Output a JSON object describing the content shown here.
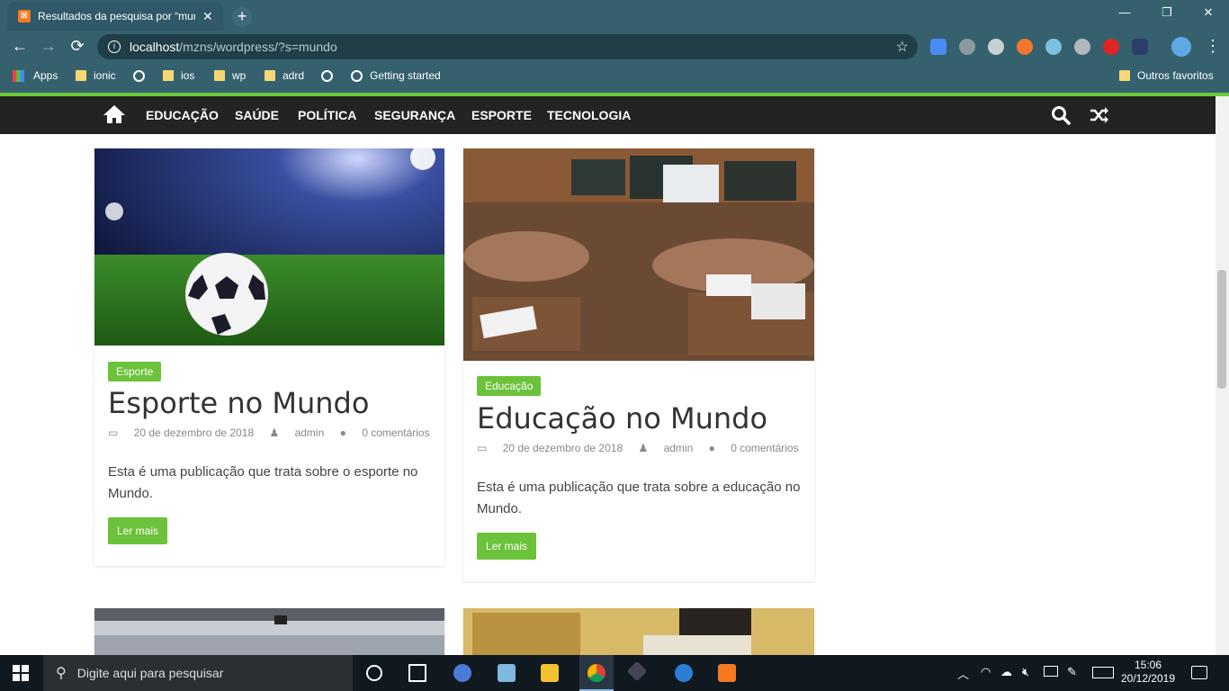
{
  "browser": {
    "tab_title": "Resultados da pesquisa por “mundo”",
    "tab_close": "✕",
    "new_tab": "+",
    "window_min": "—",
    "window_max": "❐",
    "window_close": "✕",
    "back": "←",
    "forward": "→",
    "reload": "⟳",
    "url_host": "localhost",
    "url_path": "/mzns/wordpress/?s=mundo",
    "bookmarks": [
      {
        "label": "Apps",
        "icon": "apps-grid-icon"
      },
      {
        "label": "ionic",
        "icon": "folder-icon"
      },
      {
        "label": "",
        "icon": "globe-icon"
      },
      {
        "label": "ios",
        "icon": "folder-icon"
      },
      {
        "label": "wp",
        "icon": "folder-icon"
      },
      {
        "label": "adrd",
        "icon": "folder-icon"
      },
      {
        "label": "",
        "icon": "globe-icon"
      },
      {
        "label": "Getting started",
        "icon": "globe-icon"
      }
    ],
    "other_bookmarks": "Outros favoritos"
  },
  "site_nav": {
    "items": [
      "EDUCAÇÃO",
      "SAÚDE",
      "POLÍTICA",
      "SEGURANÇA",
      "ESPORTE",
      "TECNOLOGIA"
    ]
  },
  "posts": [
    {
      "category": "Esporte",
      "title": "Esporte no Mundo",
      "date": "20 de dezembro de 2018",
      "author": "admin",
      "comments": "0 comentários",
      "excerpt": "Esta é uma publicação que trata sobre o esporte no Mundo.",
      "button": "Ler mais"
    },
    {
      "category": "Educação",
      "title": "Educação no Mundo",
      "date": "20 de dezembro de 2018",
      "author": "admin",
      "comments": "0 comentários",
      "excerpt": "Esta é uma publicação que trata sobre a educação no Mundo.",
      "button": "Ler mais"
    }
  ],
  "taskbar": {
    "search_placeholder": "Digite aqui para pesquisar",
    "time": "15:06",
    "date": "20/12/2019"
  },
  "colors": {
    "accent": "#6cc23a",
    "nav_bg": "#232323",
    "chrome_bg": "#35616e"
  }
}
